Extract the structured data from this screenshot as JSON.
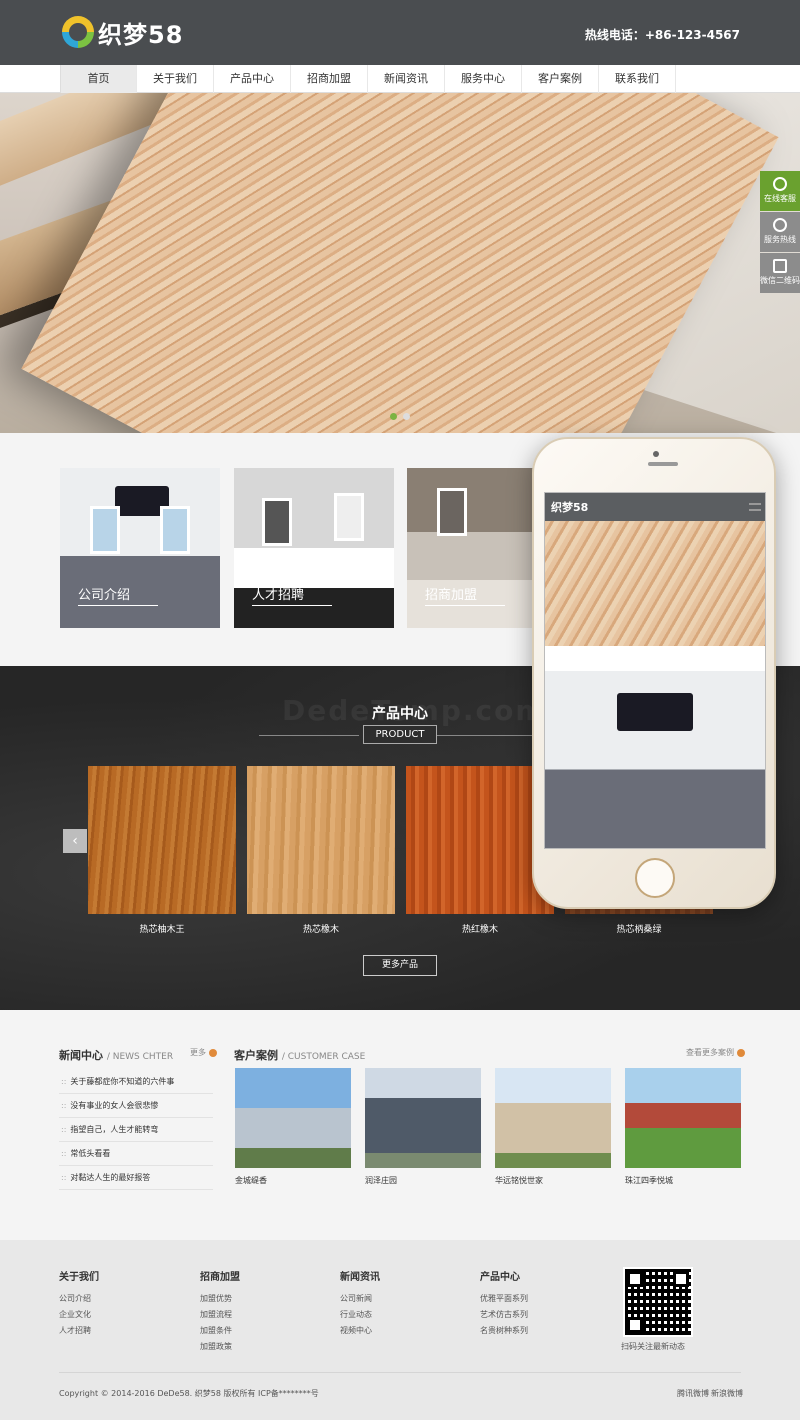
{
  "header": {
    "logo_text": "织梦58",
    "hotline": "热线电话：+86-123-4567"
  },
  "nav": {
    "items": [
      "首页",
      "关于我们",
      "产品中心",
      "招商加盟",
      "新闻资讯",
      "服务中心",
      "客户案例",
      "联系我们"
    ]
  },
  "float_bar": {
    "items": [
      "在线客服",
      "服务热线",
      "微信二维码"
    ]
  },
  "intro_cards": [
    "公司介绍",
    "人才招聘",
    "招商加盟"
  ],
  "products": {
    "ghost_text": "DedeTemp.com",
    "title": "产品中心",
    "subtitle": "PRODUCT",
    "items": [
      "热芯柚木王",
      "热芯橡木",
      "热红橡木",
      "热芯柄桑绿"
    ],
    "more_label": "更多产品",
    "prev_icon": "chevron-left-icon"
  },
  "phone": {
    "logo_text": "织梦58"
  },
  "news": {
    "title": "新闻中心",
    "title_en": "/ NEWS CHTER",
    "more": "更多",
    "items": [
      "关于藤都症你不知道的六件事",
      "没有事业的女人会很悲惨",
      "指望自己，人生才能转弯",
      "常低头看看",
      "对黏达人生的最好报答"
    ]
  },
  "cases": {
    "title": "客户案例",
    "title_en": "/ CUSTOMER CASE",
    "more": "查看更多案例",
    "items": [
      "金城缇香",
      "润泽庄园",
      "华远铭悦世家",
      "珠江四季悦城"
    ]
  },
  "footer": {
    "columns": [
      {
        "title": "关于我们",
        "links": [
          "公司介绍",
          "企业文化",
          "人才招聘"
        ]
      },
      {
        "title": "招商加盟",
        "links": [
          "加盟优势",
          "加盟流程",
          "加盟条件",
          "加盟政策"
        ]
      },
      {
        "title": "新闻资讯",
        "links": [
          "公司新闻",
          "行业动态",
          "视频中心"
        ]
      },
      {
        "title": "产品中心",
        "links": [
          "优雅平面系列",
          "艺术仿古系列",
          "名贵树种系列"
        ]
      }
    ],
    "qr_label": "扫码关注最新动态",
    "copyright": "Copyright © 2014-2016 DeDe58. 织梦58 版权所有  ICP备********号",
    "weibo_links": [
      "腾讯微博",
      "新浪微博"
    ]
  },
  "colors": {
    "header_bg": "#4a4d50",
    "accent_green": "#6aa12f",
    "products_bg": "#262626"
  }
}
